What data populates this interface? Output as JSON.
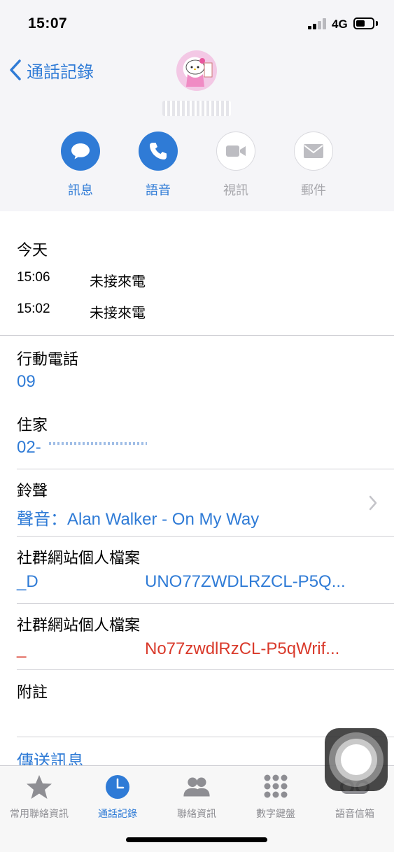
{
  "status_bar": {
    "time": "15:07",
    "network": "4G"
  },
  "nav": {
    "back_label": "通話記錄"
  },
  "actions": [
    {
      "label": "訊息",
      "icon": "message-icon",
      "enabled": true
    },
    {
      "label": "語音",
      "icon": "phone-icon",
      "enabled": true
    },
    {
      "label": "視訊",
      "icon": "video-icon",
      "enabled": false
    },
    {
      "label": "郵件",
      "icon": "mail-icon",
      "enabled": false
    }
  ],
  "recents": {
    "title": "今天",
    "calls": [
      {
        "time": "15:06",
        "status": "未接來電"
      },
      {
        "time": "15:02",
        "status": "未接來電"
      }
    ]
  },
  "fields": {
    "mobile_label": "行動電話",
    "mobile_value": "09",
    "home_label": "住家",
    "home_value": "02-",
    "ringtone_label": "鈴聲",
    "ringtone_value": "聲音：Alan Walker  - On My Way",
    "social1_label": "社群網站個人檔案",
    "social1_prefix": "_D",
    "social1_value": "UNO77ZWDLRZCL-P5Q...",
    "social2_label": "社群網站個人檔案",
    "social2_prefix": "_",
    "social2_value": "No77zwdlRzCL-P5qWrif...",
    "notes_label": "附註",
    "send_message": "傳送訊息"
  },
  "tabbar": [
    {
      "label": "常用聯絡資訊",
      "icon": "star-icon",
      "active": false
    },
    {
      "label": "通話記錄",
      "icon": "clock-icon",
      "active": true
    },
    {
      "label": "聯絡資訊",
      "icon": "contacts-icon",
      "active": false
    },
    {
      "label": "數字鍵盤",
      "icon": "keypad-icon",
      "active": false
    },
    {
      "label": "語音信箱",
      "icon": "voicemail-icon",
      "active": false
    }
  ],
  "colors": {
    "accent": "#2f7bd6",
    "alert": "#d93a2b",
    "disabled": "#a7a7ac",
    "header_bg": "#f5f5f8"
  }
}
